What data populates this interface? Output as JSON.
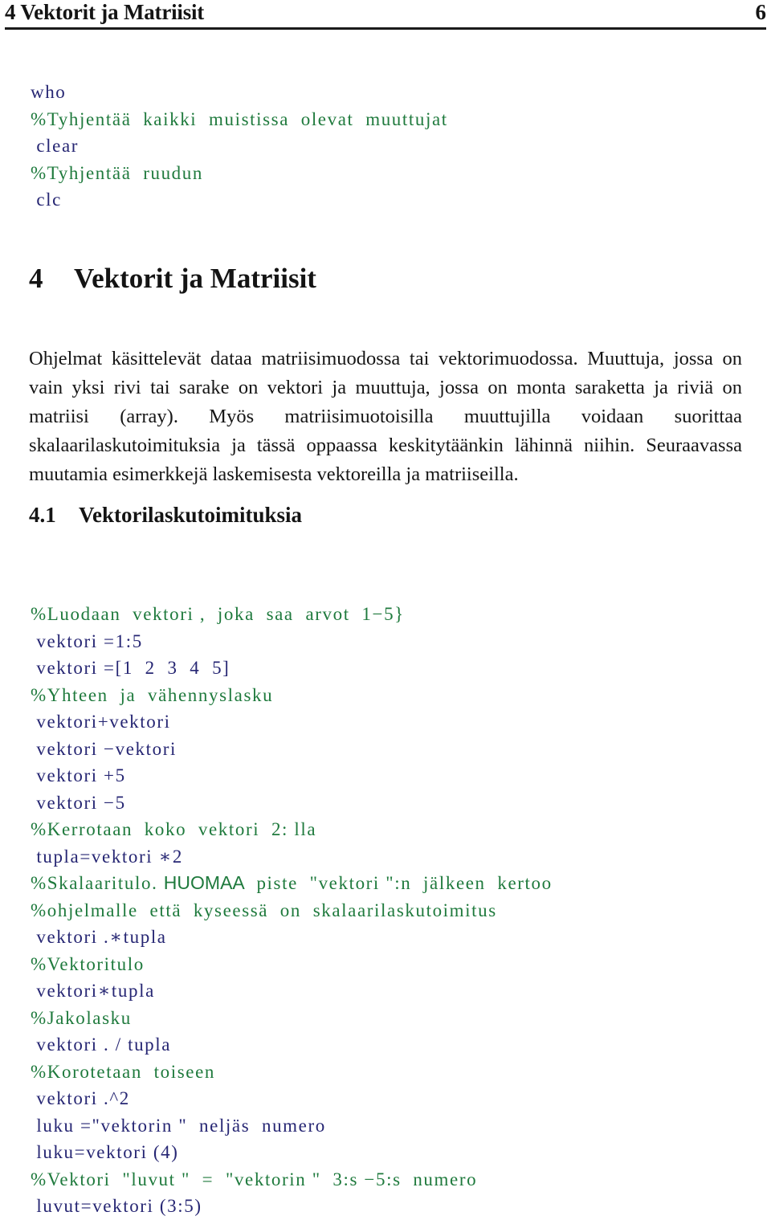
{
  "header": {
    "title": "4 Vektorit ja Matriisit",
    "page_number": "6",
    "rule_color": "#1a1a1a"
  },
  "colors": {
    "code": "#262673",
    "comment": "#1f7a3d",
    "text": "#161616"
  },
  "listing_top": {
    "lines": [
      {
        "kind": "code",
        "text": "who"
      },
      {
        "kind": "comment",
        "text": "%Tyhjentää  kaikki  muistissa  olevat  muuttujat"
      },
      {
        "kind": "code",
        "text": " clear"
      },
      {
        "kind": "comment",
        "text": "%Tyhjentää  ruudun"
      },
      {
        "kind": "code",
        "text": " clc"
      }
    ]
  },
  "section": {
    "number": "4",
    "title": "Vektorit ja Matriisit",
    "paragraph": "Ohjelmat käsittelevät dataa matriisimuodossa tai vektorimuodossa. Muuttuja, jossa on vain yksi rivi tai sarake on vektori ja muuttuja, jossa on monta saraketta ja riviä on matriisi (array). Myös matriisimuotoisilla muuttujilla voidaan suorittaa skalaarilaskutoimituksia ja tässä oppaassa keskitytäänkin lähinnä niihin. Seuraavassa muutamia esimerkkejä laskemisesta vektoreilla ja matriiseilla."
  },
  "subsection": {
    "number": "4.1",
    "title": "Vektorilaskutoimituksia"
  },
  "listing_main": {
    "lines": [
      {
        "kind": "comment",
        "text": "%Luodaan  vektori ,  joka  saa  arvot  1−5}"
      },
      {
        "kind": "code",
        "text": " vektori =1:5"
      },
      {
        "kind": "code",
        "text": " vektori =[1  2  3  4  5]"
      },
      {
        "kind": "comment",
        "text": "%Yhteen  ja  vähennyslasku"
      },
      {
        "kind": "code",
        "text": " vektori+vektori"
      },
      {
        "kind": "code",
        "text": " vektori −vektori"
      },
      {
        "kind": "code",
        "text": " vektori +5"
      },
      {
        "kind": "code",
        "text": " vektori −5"
      },
      {
        "kind": "comment",
        "text": "%Kerrotaan  koko  vektori  2: lla"
      },
      {
        "kind": "code",
        "text": " tupla=vektori ∗2"
      },
      {
        "kind": "comment",
        "text": "%Skalaaritulo. HUOMAA  piste  \"vektori \":n  jälkeen  kertoo"
      },
      {
        "kind": "comment",
        "text": "%ohjelmalle  että  kyseessä  on  skalaarilaskutoimitus"
      },
      {
        "kind": "code",
        "text": " vektori .∗tupla"
      },
      {
        "kind": "comment",
        "text": "%Vektoritulo"
      },
      {
        "kind": "code",
        "text": " vektori∗tupla"
      },
      {
        "kind": "comment",
        "text": "%Jakolasku"
      },
      {
        "kind": "code",
        "text": " vektori . / tupla"
      },
      {
        "kind": "comment",
        "text": "%Korotetaan  toiseen"
      },
      {
        "kind": "code",
        "text": " vektori .^2"
      },
      {
        "kind": "code",
        "text": " luku =\"vektorin \"  neljäs  numero"
      },
      {
        "kind": "code",
        "text": " luku=vektori (4)"
      },
      {
        "kind": "comment",
        "text": "%Vektori  \"luvut \"  =  \"vektorin \"  3:s −5:s  numero"
      },
      {
        "kind": "code",
        "text": " luvut=vektori (3:5)"
      }
    ]
  }
}
